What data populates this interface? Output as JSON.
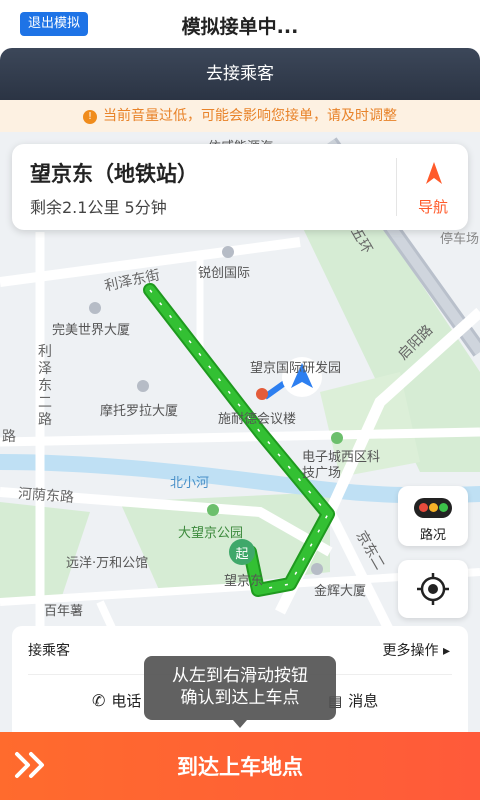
{
  "topbar": {
    "exit_label": "退出模拟",
    "title": "模拟接单中..."
  },
  "header": {
    "title": "去接乘客"
  },
  "warning": {
    "text": "当前音量过低，可能会影响您接单，请及时调整"
  },
  "destination": {
    "name": "望京东（地铁站）",
    "info": "剩余2.1公里  5分钟",
    "nav_label": "导航"
  },
  "map": {
    "labels": {
      "lize_dongjie": "利泽东街",
      "ruichuang": "锐创国际",
      "wanmei": "完美世界大厦",
      "lize_erlu": "利泽东二路",
      "motuo": "摩托罗拉大厦",
      "wangjing_yanfa": "望京国际研发园",
      "shinaide": "施耐德会议楼",
      "dianzicheng": "电子城西区科技广场",
      "beixiaohe": "北小河",
      "henan_donglu": "河荫东路",
      "dawangjing": "大望京公园",
      "yuanyang": "远洋·万和公馆",
      "wangjingdong": "望京东",
      "jinhui": "金辉大厦",
      "bainianshu": "百年薯",
      "qiyang": "启阳路",
      "wuhuan": "五环",
      "yiweineng": "依威能源汽",
      "tingchechang": "停车场",
      "lu_left": "路",
      "jingzhang": "京东二"
    },
    "start_marker": "起"
  },
  "side_buttons": {
    "traffic_label": "路况"
  },
  "pickup": {
    "title": "接乘客",
    "more_label": "更多操作 ▸",
    "call_label": "电话",
    "msg_label": "消息"
  },
  "tooltip": {
    "line1": "从左到右滑动按钮",
    "line2": "确认到达上车点"
  },
  "slide": {
    "label": "到达上车地点"
  },
  "colors": {
    "accent": "#ff5a2a",
    "route": "#2bb62b",
    "header_bg": "#2f3848",
    "exit_btn": "#1e73e6"
  }
}
